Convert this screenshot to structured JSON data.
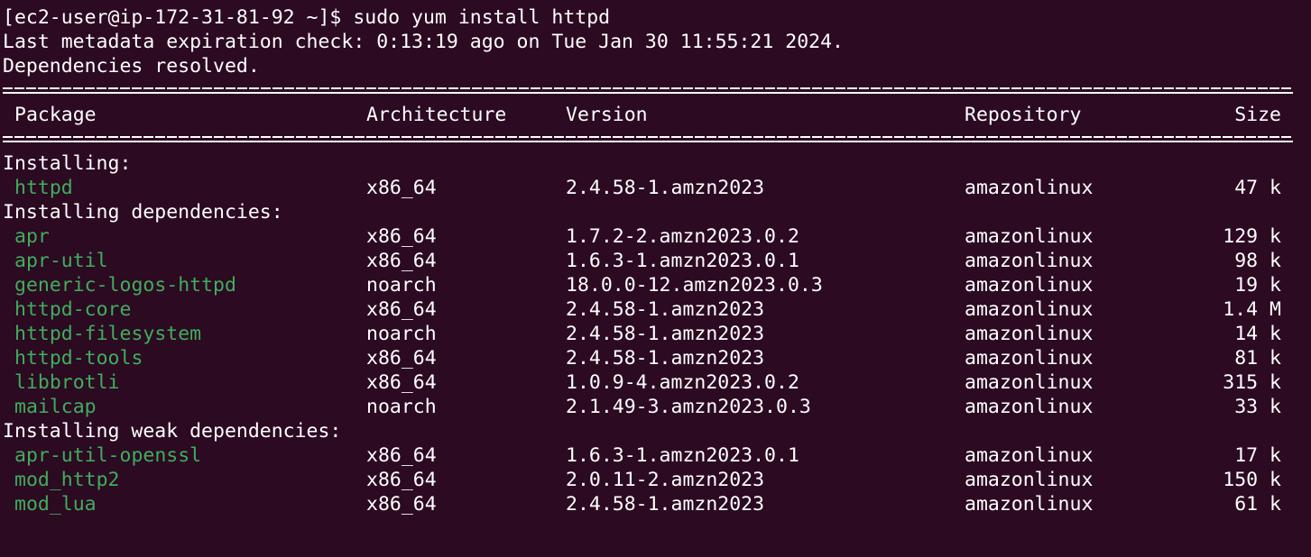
{
  "prompt": {
    "text": "[ec2-user@ip-172-31-81-92 ~]$ ",
    "command": "sudo yum install httpd"
  },
  "messages": {
    "metadata": "Last metadata expiration check: 0:13:19 ago on Tue Jan 30 11:55:21 2024.",
    "resolved": "Dependencies resolved."
  },
  "table": {
    "headers": {
      "package": "Package",
      "architecture": "Architecture",
      "version": "Version",
      "repository": "Repository",
      "size": "Size"
    },
    "sections": [
      {
        "title": "Installing:",
        "rows": [
          {
            "package": "httpd",
            "arch": "x86_64",
            "version": "2.4.58-1.amzn2023",
            "repo": "amazonlinux",
            "size": "47 k"
          }
        ]
      },
      {
        "title": "Installing dependencies:",
        "rows": [
          {
            "package": "apr",
            "arch": "x86_64",
            "version": "1.7.2-2.amzn2023.0.2",
            "repo": "amazonlinux",
            "size": "129 k"
          },
          {
            "package": "apr-util",
            "arch": "x86_64",
            "version": "1.6.3-1.amzn2023.0.1",
            "repo": "amazonlinux",
            "size": "98 k"
          },
          {
            "package": "generic-logos-httpd",
            "arch": "noarch",
            "version": "18.0.0-12.amzn2023.0.3",
            "repo": "amazonlinux",
            "size": "19 k"
          },
          {
            "package": "httpd-core",
            "arch": "x86_64",
            "version": "2.4.58-1.amzn2023",
            "repo": "amazonlinux",
            "size": "1.4 M"
          },
          {
            "package": "httpd-filesystem",
            "arch": "noarch",
            "version": "2.4.58-1.amzn2023",
            "repo": "amazonlinux",
            "size": "14 k"
          },
          {
            "package": "httpd-tools",
            "arch": "x86_64",
            "version": "2.4.58-1.amzn2023",
            "repo": "amazonlinux",
            "size": "81 k"
          },
          {
            "package": "libbrotli",
            "arch": "x86_64",
            "version": "1.0.9-4.amzn2023.0.2",
            "repo": "amazonlinux",
            "size": "315 k"
          },
          {
            "package": "mailcap",
            "arch": "noarch",
            "version": "2.1.49-3.amzn2023.0.3",
            "repo": "amazonlinux",
            "size": "33 k"
          }
        ]
      },
      {
        "title": "Installing weak dependencies:",
        "rows": [
          {
            "package": "apr-util-openssl",
            "arch": "x86_64",
            "version": "1.6.3-1.amzn2023.0.1",
            "repo": "amazonlinux",
            "size": "17 k"
          },
          {
            "package": "mod_http2",
            "arch": "x86_64",
            "version": "2.0.11-2.amzn2023",
            "repo": "amazonlinux",
            "size": "150 k"
          },
          {
            "package": "mod_lua",
            "arch": "x86_64",
            "version": "2.4.58-1.amzn2023",
            "repo": "amazonlinux",
            "size": "61 k"
          }
        ]
      }
    ]
  },
  "colors": {
    "background": "#2c0a22",
    "text": "#ffffff",
    "package_name": "#3fae5c"
  }
}
